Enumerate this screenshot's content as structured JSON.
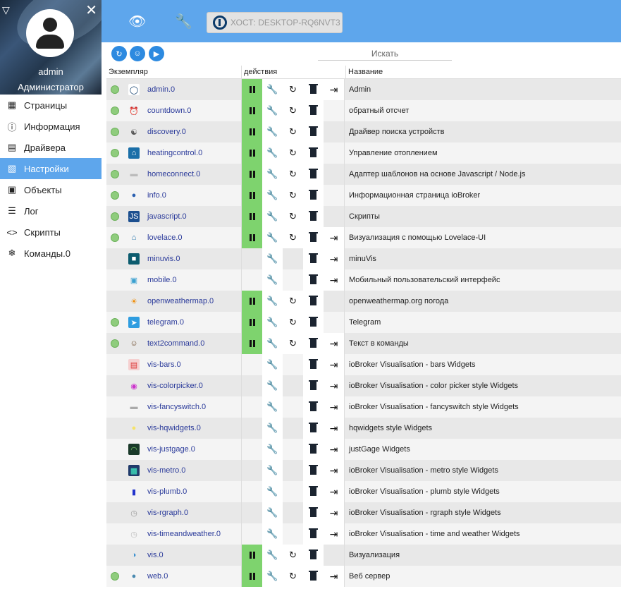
{
  "sidebar": {
    "user_name": "admin",
    "user_role": "Администратор",
    "items": [
      {
        "label": "Страницы",
        "icon": "grid-icon",
        "active": false
      },
      {
        "label": "Информация",
        "icon": "info-icon",
        "active": false
      },
      {
        "label": "Драйвера",
        "icon": "store-icon",
        "active": false
      },
      {
        "label": "Настройки",
        "icon": "settings-panel-icon",
        "active": true
      },
      {
        "label": "Объекты",
        "icon": "objects-icon",
        "active": false
      },
      {
        "label": "Лог",
        "icon": "log-icon",
        "active": false
      },
      {
        "label": "Скрипты",
        "icon": "code-icon",
        "active": false
      },
      {
        "label": "Команды.0",
        "icon": "snowflake-icon",
        "active": false
      }
    ]
  },
  "topbar": {
    "host_label": "ХОСТ: DESKTOP-RQ6NVT3",
    "accent_color": "#5ea6ec"
  },
  "toolbar": {
    "search_placeholder": "Искать"
  },
  "table": {
    "headers": [
      "Экземпляр",
      "действия",
      "Название"
    ],
    "rows": [
      {
        "status": true,
        "icon": "admin-icon",
        "name": "admin.0",
        "pause": true,
        "config": "active",
        "restart": true,
        "delete": true,
        "link": true,
        "title": "Admin"
      },
      {
        "status": true,
        "icon": "alarm-clock-icon",
        "name": "countdown.0",
        "pause": true,
        "config": "active",
        "restart": true,
        "delete": true,
        "link": false,
        "title": "обратный отсчет"
      },
      {
        "status": true,
        "icon": "discovery-icon",
        "name": "discovery.0",
        "pause": true,
        "config": "active",
        "restart": true,
        "delete": true,
        "link": false,
        "title": "Драйвер поиска устройств"
      },
      {
        "status": true,
        "icon": "house-icon",
        "name": "heatingcontrol.0",
        "pause": true,
        "config": "active",
        "restart": true,
        "delete": true,
        "link": false,
        "title": "Управление отоплением"
      },
      {
        "status": true,
        "icon": "homeconnect-icon",
        "name": "homeconnect.0",
        "pause": true,
        "config": "active",
        "restart": true,
        "delete": true,
        "link": false,
        "title": "Адаптер шаблонов на основе Javascript / Node.js"
      },
      {
        "status": true,
        "icon": "info-globe-icon",
        "name": "info.0",
        "pause": true,
        "config": "active",
        "restart": true,
        "delete": true,
        "link": false,
        "title": "Информационная страница ioBroker"
      },
      {
        "status": true,
        "icon": "javascript-icon",
        "name": "javascript.0",
        "pause": true,
        "config": "active",
        "restart": true,
        "delete": true,
        "link": false,
        "title": "Скрипты"
      },
      {
        "status": true,
        "icon": "lovelace-icon",
        "name": "lovelace.0",
        "pause": true,
        "config": "active",
        "restart": true,
        "delete": true,
        "link": true,
        "title": "Визуализация с помощью Lovelace-UI"
      },
      {
        "status": false,
        "icon": "minuvis-icon",
        "name": "minuvis.0",
        "pause": false,
        "config": "faded",
        "restart": false,
        "delete": true,
        "link": true,
        "title": "minuVis"
      },
      {
        "status": false,
        "icon": "mobile-icon",
        "name": "mobile.0",
        "pause": false,
        "config": "faded",
        "restart": false,
        "delete": true,
        "link": true,
        "title": "Мобильный пользовательский интерфейс"
      },
      {
        "status": false,
        "icon": "sun-icon",
        "name": "openweathermap.0",
        "pause": true,
        "config": "active",
        "restart": true,
        "delete": true,
        "link": false,
        "title": "openweathermap.org погода"
      },
      {
        "status": true,
        "icon": "telegram-icon",
        "name": "telegram.0",
        "pause": true,
        "config": "active",
        "restart": true,
        "delete": true,
        "link": false,
        "title": "Telegram"
      },
      {
        "status": true,
        "icon": "text2command-icon",
        "name": "text2command.0",
        "pause": true,
        "config": "faded",
        "restart": true,
        "delete": true,
        "link": true,
        "title": "Текст в команды"
      },
      {
        "status": false,
        "icon": "bars-widget-icon",
        "name": "vis-bars.0",
        "pause": false,
        "config": "active",
        "restart": false,
        "delete": true,
        "link": true,
        "title": "ioBroker Visualisation - bars Widgets"
      },
      {
        "status": false,
        "icon": "colorpicker-icon",
        "name": "vis-colorpicker.0",
        "pause": false,
        "config": "faded",
        "restart": false,
        "delete": true,
        "link": true,
        "title": "ioBroker Visualisation - color picker style Widgets"
      },
      {
        "status": false,
        "icon": "fancyswitch-icon",
        "name": "vis-fancyswitch.0",
        "pause": false,
        "config": "faded",
        "restart": false,
        "delete": true,
        "link": true,
        "title": "ioBroker Visualisation - fancyswitch style Widgets"
      },
      {
        "status": false,
        "icon": "bulb-icon",
        "name": "vis-hqwidgets.0",
        "pause": false,
        "config": "faded",
        "restart": false,
        "delete": true,
        "link": true,
        "title": "hqwidgets style Widgets"
      },
      {
        "status": false,
        "icon": "justgage-icon",
        "name": "vis-justgage.0",
        "pause": false,
        "config": "faded",
        "restart": false,
        "delete": true,
        "link": true,
        "title": "justGage Widgets"
      },
      {
        "status": false,
        "icon": "metro-icon",
        "name": "vis-metro.0",
        "pause": false,
        "config": "faded",
        "restart": false,
        "delete": true,
        "link": true,
        "title": "ioBroker Visualisation - metro style Widgets"
      },
      {
        "status": false,
        "icon": "plumb-icon",
        "name": "vis-plumb.0",
        "pause": false,
        "config": "faded",
        "restart": false,
        "delete": true,
        "link": true,
        "title": "ioBroker Visualisation - plumb style Widgets"
      },
      {
        "status": false,
        "icon": "rgraph-icon",
        "name": "vis-rgraph.0",
        "pause": false,
        "config": "active",
        "restart": false,
        "delete": true,
        "link": true,
        "title": "ioBroker Visualisation - rgraph style Widgets"
      },
      {
        "status": false,
        "icon": "timeandweather-icon",
        "name": "vis-timeandweather.0",
        "pause": false,
        "config": "faded",
        "restart": false,
        "delete": true,
        "link": true,
        "title": "ioBroker Visualisation - time and weather Widgets"
      },
      {
        "status": false,
        "icon": "vis-icon",
        "name": "vis.0",
        "pause": true,
        "config": "active",
        "restart": true,
        "delete": true,
        "link": false,
        "title": "Визуализация"
      },
      {
        "status": true,
        "icon": "web-icon",
        "name": "web.0",
        "pause": true,
        "config": "active",
        "restart": true,
        "delete": true,
        "link": true,
        "title": "Веб сервер"
      }
    ]
  }
}
